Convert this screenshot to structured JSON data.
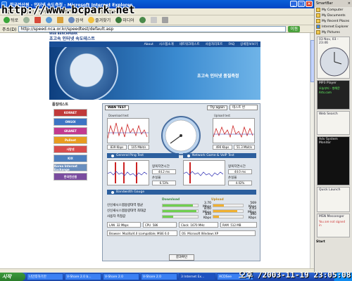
{
  "watermark": "http://www.bcpark.net",
  "window": {
    "title": "한국전산원 - 인터넷 속도측정 - Microsoft Internet Explorer"
  },
  "menubar": {
    "items": [
      "파일(F)",
      "편집(E)",
      "보기(V)",
      "즐겨찾기(A)",
      "도구(T)",
      "도움말(H)"
    ]
  },
  "toolbar": {
    "back": "뒤로",
    "search": "검색",
    "favorites": "즐겨찾기",
    "media": "미디어"
  },
  "address": {
    "label": "주소(D)",
    "url": "http://speed.nca.or.kr/speedtest/default.asp",
    "go": "이동"
  },
  "site": {
    "logo_small": "WEB BENCHMARK",
    "logo_main": "초고속 인터넷 속도테스트",
    "nav": [
      "About",
      "시스템소개",
      "네트워크테스트",
      "사용자리포트",
      "FAQ",
      "상세정보보기"
    ],
    "hero_title": "초고속 인터넷 품질측정"
  },
  "sidebar": {
    "title": "품질테스트",
    "logos": [
      {
        "label": "KORNET",
        "color": "#c03a3a"
      },
      {
        "label": "ONGOI",
        "color": "#3c74c4"
      },
      {
        "label": "6KANET",
        "color": "#c23a8f"
      },
      {
        "label": "Pullnet",
        "color": "#e89c20"
      },
      {
        "label": "사랑넷",
        "color": "#d84c4c"
      },
      {
        "label": "KIX",
        "color": "#4c7fbf"
      },
      {
        "label": "Korea Internet Exchange",
        "color": "#6a8fbf"
      },
      {
        "label": "한국전산원",
        "color": "#7a4c9f"
      }
    ]
  },
  "test": {
    "tab": "WAN TEST",
    "try_again": "Try again",
    "select_value": "테스트 번",
    "download_label": "Download test",
    "upload_label": "Upload test",
    "download_stats": [
      "839 Kbps",
      "105 Mbit/s"
    ],
    "upload_stats": [
      "490 Kbps",
      "51.3 Mbit/s"
    ],
    "ping_section": "General Ping Test",
    "voip_section": "Network Game & VoIP Test",
    "ping_values": [
      "44.2 ms",
      "6.53%"
    ],
    "voip_values": [
      "44.0 ms",
      "4.02%"
    ],
    "ping_labels": [
      "왕복지연시간",
      "손실율"
    ],
    "bandwidth_section": "Bandwidth Gauge",
    "table_headers": [
      "Download",
      "Upload"
    ],
    "rows": [
      {
        "label": "신신새시스템용량대역 평균",
        "down": "3.70 Mbps",
        "up": "569 Kbps",
        "down_frac": 0.85,
        "up_frac": 0.35
      },
      {
        "label": "신신새시스템용량대역 최대값",
        "down": "8.00 Mbps",
        "up": "4.03 Mbps",
        "down_frac": 0.95,
        "up_frac": 0.8
      },
      {
        "label": "사용자 측정값",
        "down": "839 Kbps",
        "up": "490 Kbps",
        "down_frac": 0.3,
        "up_frac": 0.2
      }
    ],
    "info": [
      {
        "label": "LAN",
        "value": "32 Mbps"
      },
      {
        "label": "CPU",
        "value": "586"
      },
      {
        "label": "Clock",
        "value": "1670 MHz"
      },
      {
        "label": "RAM",
        "value": "512 MB"
      }
    ],
    "browser": {
      "label": "Browser",
      "value": "Mozilla/4.0 (compatible; MSIE 6.0"
    },
    "os": {
      "label": "OS",
      "value": "Microsoft Windows XP"
    },
    "confirm": "결과확인"
  },
  "smartbar": {
    "title": "SmartBar",
    "items": [
      "My Computer",
      "My Documents",
      "My Recent Places",
      "Internet Explorer",
      "My Pictures"
    ],
    "clock_date": "03 Nov, 03 - 23:46",
    "mp3_title": "MP3 Player",
    "mp3_track": "오늘부터 - 향해문Arts.com",
    "web_search": "Web Search",
    "adv_monitor": "Adv System Monitor",
    "quick_launch": "Quick Launch",
    "msn": "MSN Messenger",
    "msn_status": "You are not signed in",
    "footer": "Start"
  },
  "taskbar": {
    "start": "시작",
    "items": [
      "나만후하기만",
      "V-Share 2.0 b...",
      "V-Share 2.0",
      "V-Share 2.0",
      "3 Internet Ex...",
      "ACDSee"
    ]
  },
  "timestamp": "오후 /2003-11-19 23:05:08",
  "colors": {
    "accent": "#1a4f97",
    "download_line": "#cc2222",
    "upload_line": "#cc2222",
    "ping_line": "#4444bb"
  }
}
